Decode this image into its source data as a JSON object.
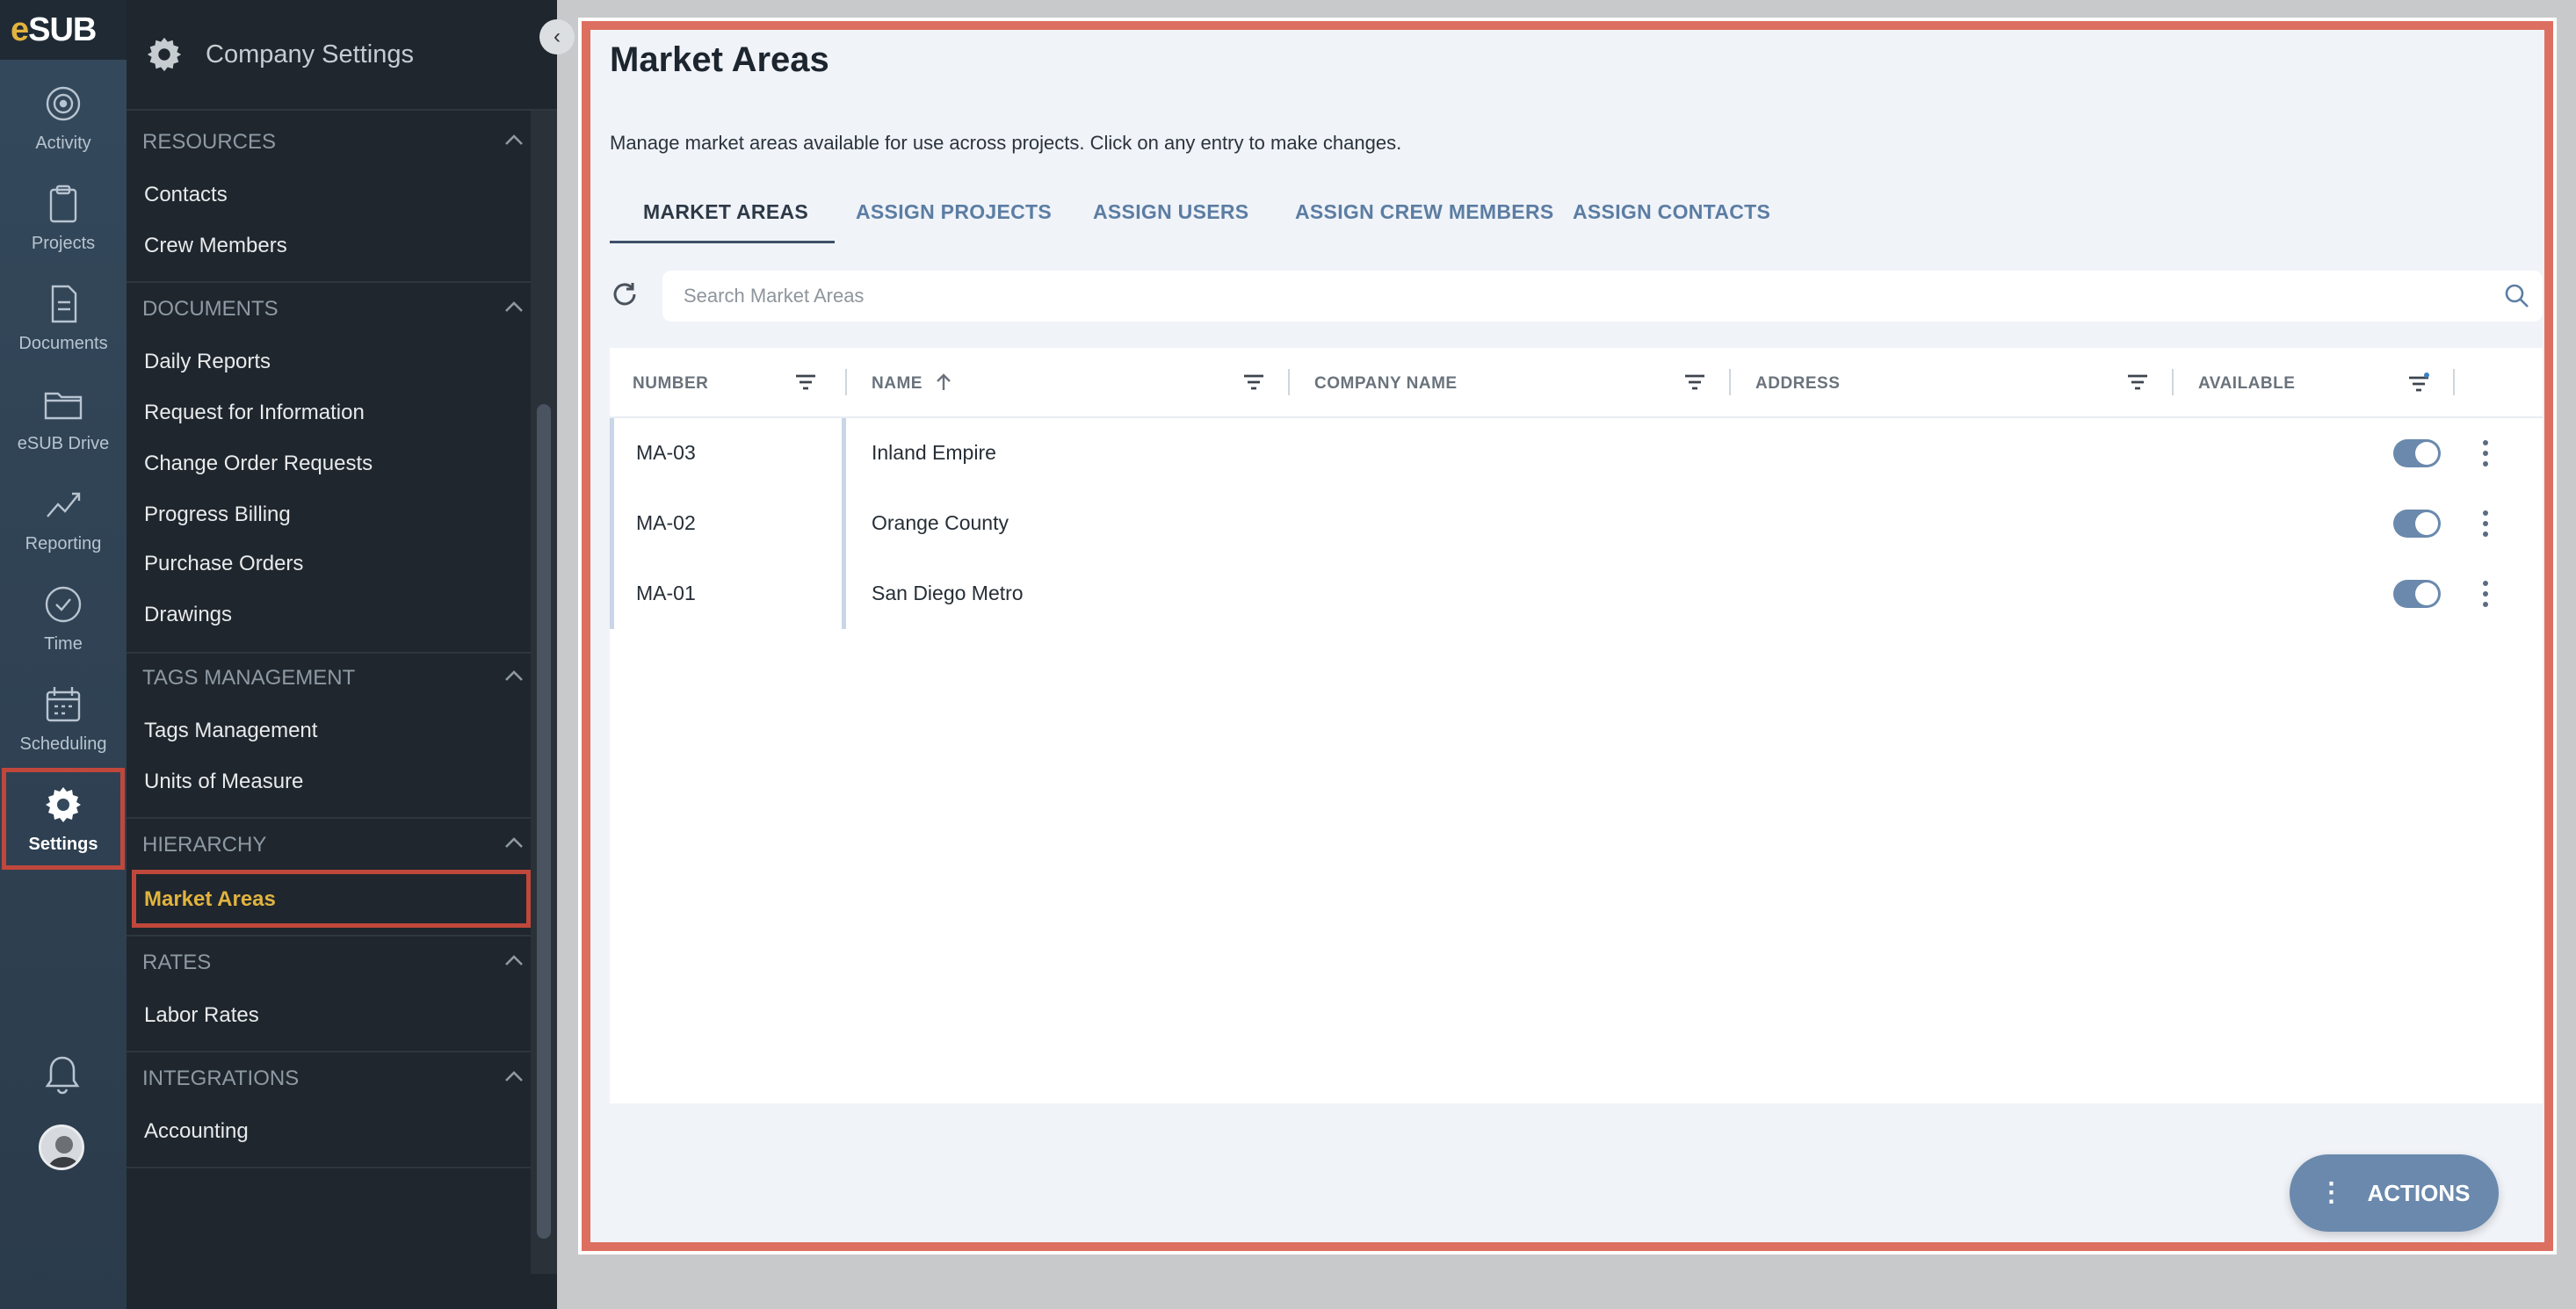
{
  "rail": {
    "logo_e": "e",
    "logo_text": "SUB",
    "items": [
      {
        "label": "Activity",
        "icon": "activity-icon"
      },
      {
        "label": "Projects",
        "icon": "clipboard-icon"
      },
      {
        "label": "Documents",
        "icon": "document-icon"
      },
      {
        "label": "eSUB Drive",
        "icon": "folder-icon"
      },
      {
        "label": "Reporting",
        "icon": "chart-line-icon"
      },
      {
        "label": "Time",
        "icon": "clock-icon"
      },
      {
        "label": "Scheduling",
        "icon": "calendar-icon"
      },
      {
        "label": "Settings",
        "icon": "gear-icon"
      }
    ]
  },
  "sidebar": {
    "title": "Company Settings",
    "sections": [
      {
        "title": "RESOURCES",
        "links": [
          "Contacts",
          "Crew Members"
        ]
      },
      {
        "title": "DOCUMENTS",
        "links": [
          "Daily Reports",
          "Request for Information",
          "Change Order Requests",
          "Progress Billing",
          "Purchase Orders",
          "Drawings"
        ]
      },
      {
        "title": "TAGS MANAGEMENT",
        "links": [
          "Tags Management",
          "Units of Measure"
        ]
      },
      {
        "title": "HIERARCHY",
        "links": [
          "Market Areas"
        ]
      },
      {
        "title": "RATES",
        "links": [
          "Labor Rates"
        ]
      },
      {
        "title": "INTEGRATIONS",
        "links": [
          "Accounting"
        ]
      }
    ]
  },
  "main": {
    "title": "Market Areas",
    "subtitle": "Manage market areas available for use across projects. Click on any entry to make changes.",
    "tabs": [
      "MARKET AREAS",
      "ASSIGN PROJECTS",
      "ASSIGN USERS",
      "ASSIGN CREW MEMBERS",
      "ASSIGN CONTACTS"
    ],
    "search_placeholder": "Search Market Areas",
    "columns": [
      "NUMBER",
      "NAME",
      "COMPANY NAME",
      "ADDRESS",
      "AVAILABLE"
    ],
    "rows": [
      {
        "number": "MA-03",
        "name": "Inland Empire",
        "available": true
      },
      {
        "number": "MA-02",
        "name": "Orange County",
        "available": true
      },
      {
        "number": "MA-01",
        "name": "San Diego Metro",
        "available": true
      }
    ],
    "actions_label": "ACTIONS"
  },
  "colors": {
    "highlight": "#dd6f60",
    "accent": "#6a89ad",
    "selected_link": "#e2b33e"
  }
}
